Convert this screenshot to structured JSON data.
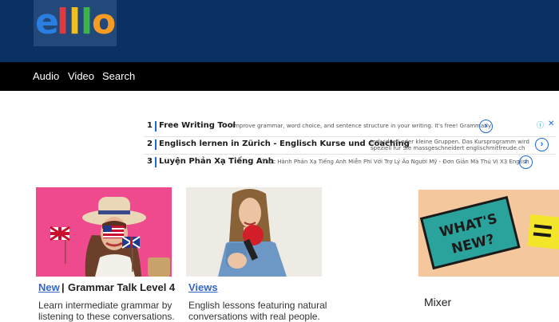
{
  "logo": {
    "letters": [
      "e",
      "l",
      "l",
      "l",
      "o"
    ],
    "colors": [
      "#2a7de1",
      "#e23a3a",
      "#f0c020",
      "#3bb54a",
      "#f59a23"
    ]
  },
  "nav": {
    "items": [
      "Audio",
      "Video",
      "Search"
    ]
  },
  "ads": [
    {
      "num": "1",
      "title": "Free Writing Tool",
      "desc": "Improve grammar, word choice, and sentence structure in your writing. It's free! Grammarly",
      "arrow": "›"
    },
    {
      "num": "2",
      "title": "Englisch lernen in Zürich - Englisch Kurse und Coaching",
      "desc": "Individuell oder kleine Gruppen. Das Kursprogramm wird speziell für Sie massgeschneidert englischmitfreude.ch",
      "arrow": "›"
    },
    {
      "num": "3",
      "title": "Luyện Phản Xạ Tiếng Anh",
      "desc": "Thực Hành Phản Xạ Tiếng Anh Miễn Phí Với Trợ Lý Ảo Người Mỹ - Đơn Giản Mà Thú Vị X3 English",
      "arrow": "›"
    }
  ],
  "ad_choices": {
    "info": "ⓘ",
    "close": "✕"
  },
  "cards": [
    {
      "link": "New",
      "sep": "|",
      "title": "Grammar Talk Level 4",
      "desc": "Learn intermediate grammar by listening to these conversations."
    },
    {
      "link": "Views",
      "desc": "English lessons featuring natural conversations with real people."
    }
  ],
  "mixer": {
    "label": "Mixer",
    "sign_text": "WHAT'S NEW?"
  },
  "colors": {
    "header": "#0b3163",
    "nav": "#000000",
    "link": "#3366cc"
  }
}
